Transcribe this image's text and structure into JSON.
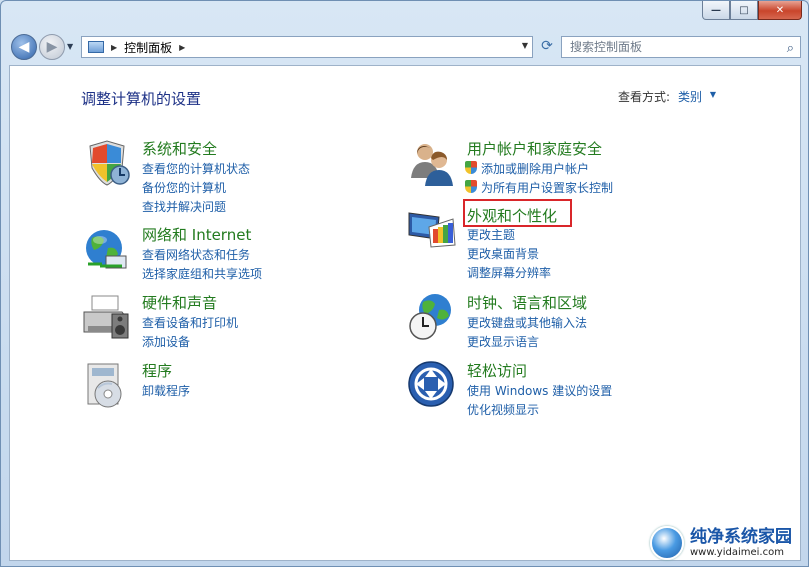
{
  "window": {
    "buttons": {
      "minimize": "—",
      "maximize": "□",
      "close": "✕"
    }
  },
  "toolbar": {
    "back_icon": "arrow-left-icon",
    "forward_icon": "arrow-right-icon",
    "address": {
      "breadcrumb": "控制面板"
    },
    "search": {
      "placeholder": "搜索控制面板"
    }
  },
  "page": {
    "title": "调整计算机的设置",
    "view_by_label": "查看方式:",
    "view_by_value": "类别"
  },
  "categories": [
    {
      "title": "系统和安全",
      "icon": "shield-icon",
      "links": [
        "查看您的计算机状态",
        "备份您的计算机",
        "查找并解决问题"
      ]
    },
    {
      "title": "网络和 Internet",
      "icon": "globe-network-icon",
      "links": [
        "查看网络状态和任务",
        "选择家庭组和共享选项"
      ]
    },
    {
      "title": "硬件和声音",
      "icon": "printer-icon",
      "links": [
        "查看设备和打印机",
        "添加设备"
      ]
    },
    {
      "title": "程序",
      "icon": "programs-icon",
      "links": [
        "卸载程序"
      ]
    },
    {
      "title": "用户帐户和家庭安全",
      "icon": "users-icon",
      "links": [
        "添加或删除用户帐户",
        "为所有用户设置家长控制"
      ]
    },
    {
      "title": "外观和个性化",
      "icon": "monitor-paint-icon",
      "links": [
        "更改主题",
        "更改桌面背景",
        "调整屏幕分辨率"
      ]
    },
    {
      "title": "时钟、语言和区域",
      "icon": "clock-globe-icon",
      "links": [
        "更改键盘或其他输入法",
        "更改显示语言"
      ]
    },
    {
      "title": "轻松访问",
      "icon": "ease-of-access-icon",
      "links": [
        "使用 Windows 建议的设置",
        "优化视频显示"
      ]
    }
  ],
  "watermark": {
    "name": "纯净系统家园",
    "url": "www.yidaimei.com"
  },
  "colors": {
    "category_title": "#237b1f",
    "link": "#1f5fa8",
    "page_title": "#1e3287",
    "highlight": "#d9262a"
  }
}
